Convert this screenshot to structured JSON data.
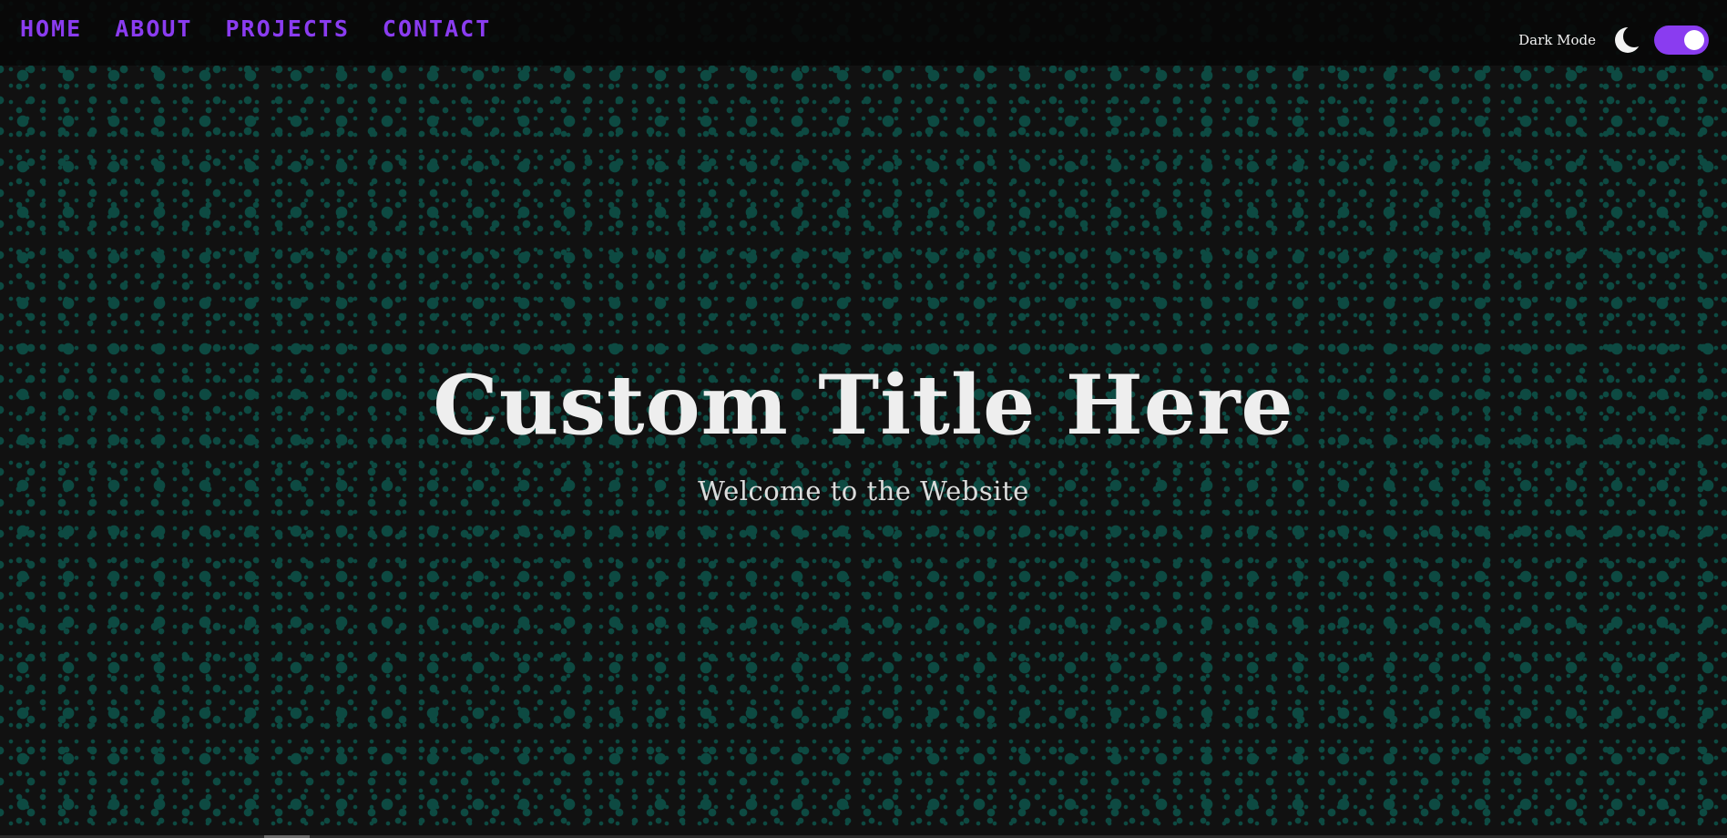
{
  "nav": {
    "items": [
      {
        "label": "HOME"
      },
      {
        "label": "ABOUT"
      },
      {
        "label": "PROJECTS"
      },
      {
        "label": "CONTACT"
      }
    ]
  },
  "mode": {
    "label": "Dark Mode",
    "icon": "moon-icon",
    "toggle_state": "on"
  },
  "hero": {
    "title": "Custom Title Here",
    "subtitle": "Welcome to the Website"
  },
  "colors": {
    "accent": "#8a3cf0",
    "background": "#111111",
    "dots": "#0d4a42",
    "text": "#eeeeee"
  }
}
